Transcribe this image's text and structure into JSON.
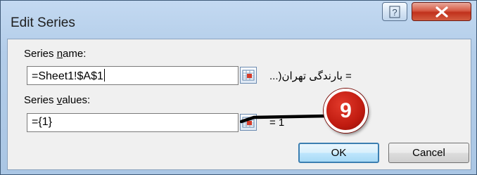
{
  "window": {
    "title": "Edit Series"
  },
  "titlebar": {
    "help_label": "?",
    "close_label": "X"
  },
  "series_name": {
    "label_before": "Series ",
    "label_accel": "n",
    "label_after": "ame:",
    "value": "=Sheet1!$A$1",
    "preview": "= بارندگی تهران(..."
  },
  "series_values": {
    "label_before": "Series ",
    "label_accel": "v",
    "label_after": "alues:",
    "value": "={1}",
    "preview": "= 1"
  },
  "buttons": {
    "ok_label": "OK",
    "cancel_label": "Cancel"
  },
  "annotation": {
    "step_number": "9"
  },
  "colors": {
    "accent_ok_border": "#3c7fb1",
    "badge": "#c01b10",
    "close": "#c1311c"
  },
  "icons": {
    "ref_button": "range-select-icon",
    "close": "close-icon",
    "help": "help-icon"
  }
}
